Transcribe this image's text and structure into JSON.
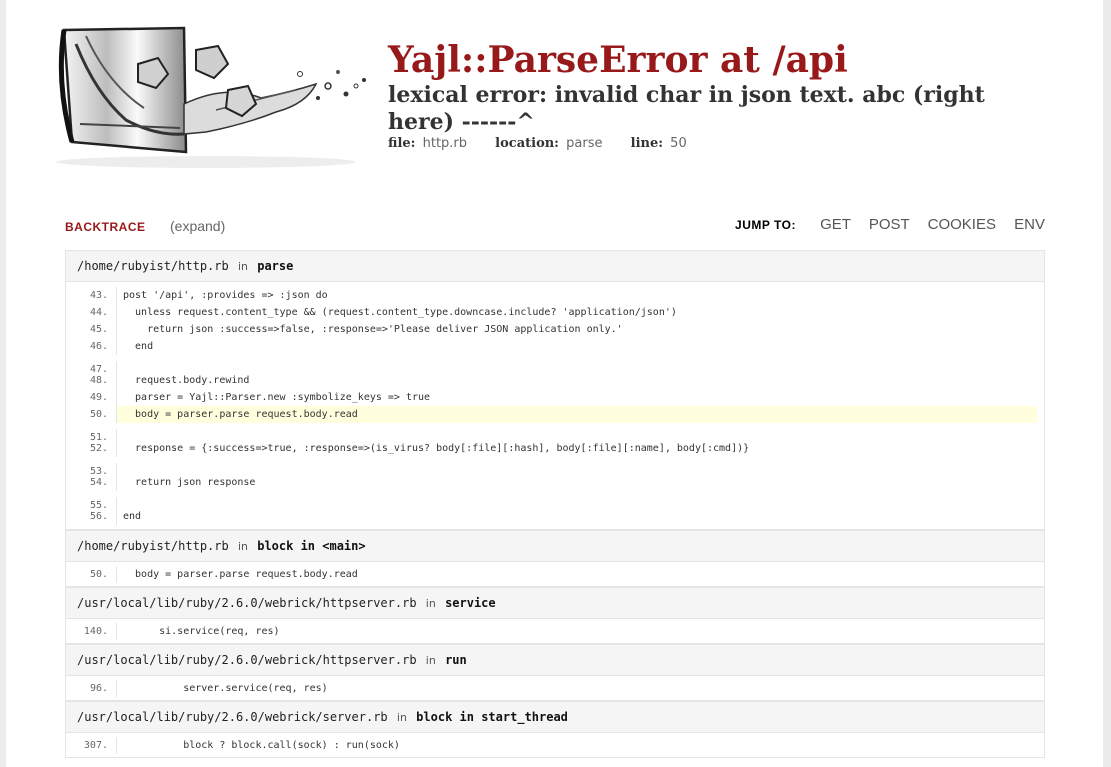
{
  "header": {
    "title": "Yajl::ParseError at /api",
    "subtitle": "lexical error: invalid char in json text. abc (right here) ------^",
    "file_label": "file:",
    "file_value": "http.rb",
    "location_label": "location:",
    "location_value": "parse",
    "line_label": "line:",
    "line_value": "50"
  },
  "backtrace": {
    "label": "BACKTRACE",
    "expand": "(expand)",
    "jump_to": "JUMP TO:",
    "links": [
      "GET",
      "POST",
      "COOKIES",
      "ENV"
    ]
  },
  "frames": [
    {
      "file": "/home/rubyist/http.rb",
      "in": "in",
      "fn": "parse",
      "lines": [
        {
          "no": "43.",
          "code": "post '/api', :provides => :json do"
        },
        {
          "no": "44.",
          "code": "  unless request.content_type && (request.content_type.downcase.include? 'application/json')"
        },
        {
          "no": "45.",
          "code": "    return json :success=>false, :response=>'Please deliver JSON application only.'"
        },
        {
          "no": "46.",
          "code": "  end"
        },
        {
          "no": "47.",
          "code": ""
        },
        {
          "no": "48.",
          "code": "  request.body.rewind"
        },
        {
          "no": "49.",
          "code": "  parser = Yajl::Parser.new :symbolize_keys => true"
        },
        {
          "no": "50.",
          "code": "  body = parser.parse request.body.read",
          "active": true
        },
        {
          "no": "51.",
          "code": ""
        },
        {
          "no": "52.",
          "code": "  response = {:success=>true, :response=>(is_virus? body[:file][:hash], body[:file][:name], body[:cmd])}"
        },
        {
          "no": "53.",
          "code": ""
        },
        {
          "no": "54.",
          "code": "  return json response"
        },
        {
          "no": "55.",
          "code": ""
        },
        {
          "no": "56.",
          "code": "end"
        }
      ]
    },
    {
      "file": "/home/rubyist/http.rb",
      "in": "in",
      "fn": "block in <main>",
      "lines": [
        {
          "no": "50.",
          "code": "  body = parser.parse request.body.read"
        }
      ]
    },
    {
      "file": "/usr/local/lib/ruby/2.6.0/webrick/httpserver.rb",
      "in": "in",
      "fn": "service",
      "lines": [
        {
          "no": "140.",
          "code": "      si.service(req, res)"
        }
      ]
    },
    {
      "file": "/usr/local/lib/ruby/2.6.0/webrick/httpserver.rb",
      "in": "in",
      "fn": "run",
      "lines": [
        {
          "no": "96.",
          "code": "          server.service(req, res)"
        }
      ]
    },
    {
      "file": "/usr/local/lib/ruby/2.6.0/webrick/server.rb",
      "in": "in",
      "fn": "block in start_thread",
      "lines": [
        {
          "no": "307.",
          "code": "          block ? block.call(sock) : run(sock)"
        }
      ]
    }
  ]
}
